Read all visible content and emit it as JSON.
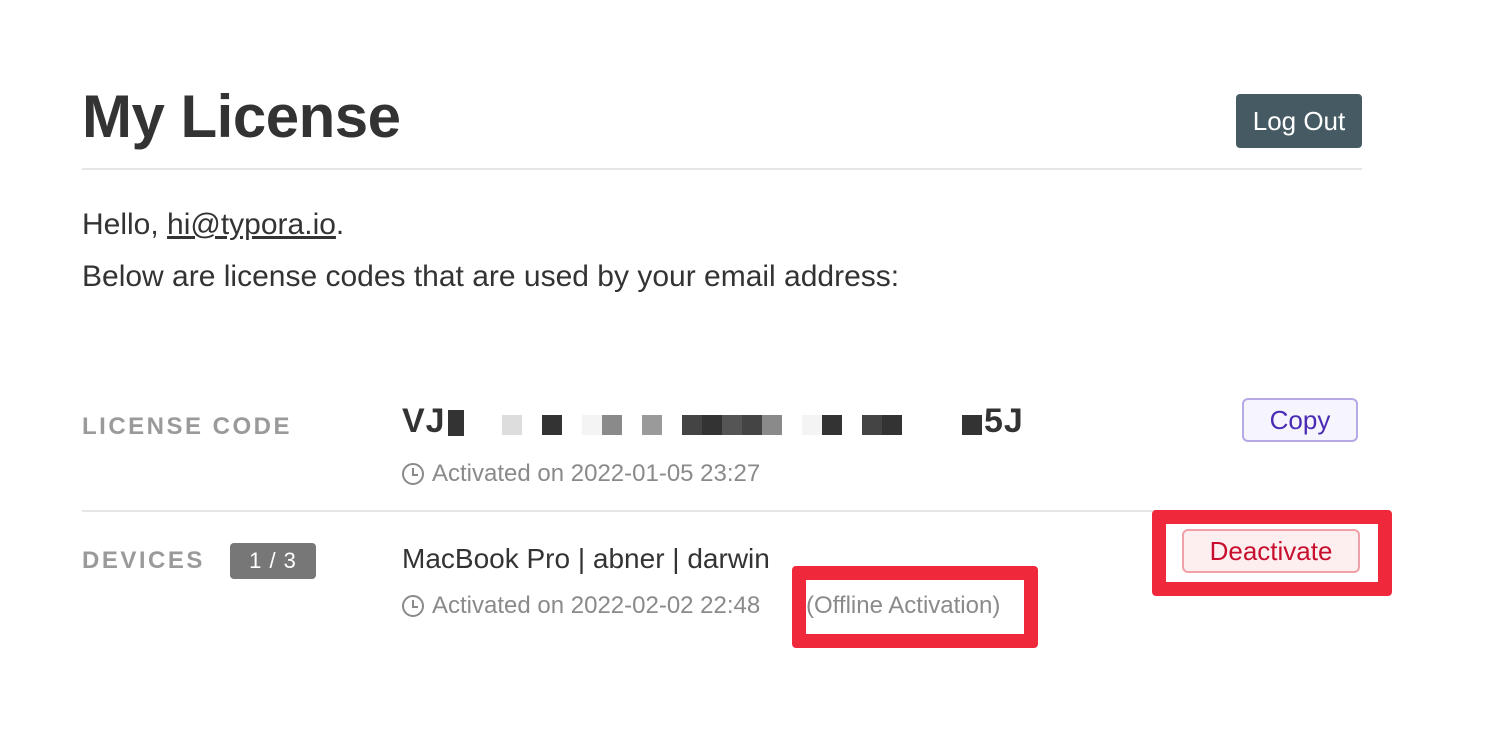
{
  "header": {
    "title": "My License",
    "logout_label": "Log Out"
  },
  "greeting": {
    "prefix": "Hello, ",
    "email": "hi@typora.io",
    "suffix": "."
  },
  "intro": "Below are license codes that are used by your email address:",
  "license": {
    "section_label": "LICENSE CODE",
    "code_prefix": "VJ",
    "code_suffix": "5J",
    "activated": "Activated on 2022-01-05 23:27",
    "copy_label": "Copy"
  },
  "devices": {
    "section_label": "DEVICES",
    "count": "1 / 3",
    "items": [
      {
        "name": "MacBook Pro | abner | darwin",
        "activated": "Activated on 2022-02-02 22:48",
        "note": "(Offline Activation)",
        "deactivate_label": "Deactivate"
      }
    ]
  },
  "colors": {
    "logout_bg": "#465a64",
    "copy_text": "#4a2bb5",
    "deactivate_text": "#c8102e",
    "highlight": "#f0283c"
  }
}
